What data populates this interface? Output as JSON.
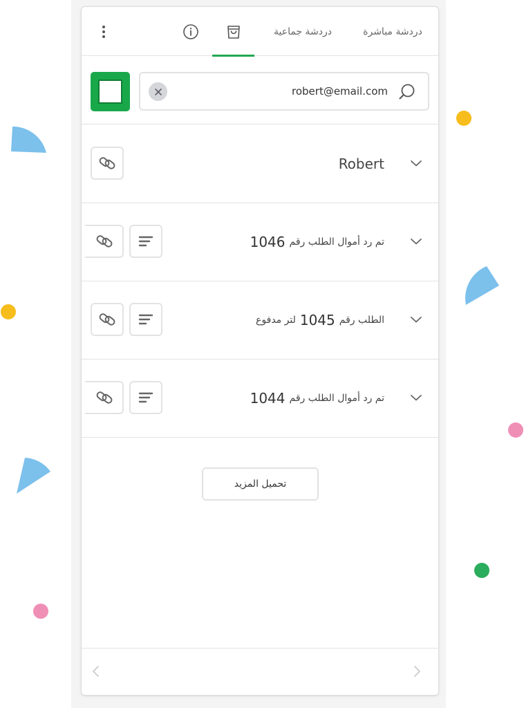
{
  "tabs": {
    "live_chat": "دردشة مباشرة",
    "group_chat": "دردشة جماعية",
    "active_tab": "cart"
  },
  "search": {
    "value": "robert@email.com"
  },
  "rows": [
    {
      "prefix": "",
      "number": "",
      "suffix": "Robert"
    },
    {
      "prefix": "تم رد أموال الطلب رقم",
      "number": "1046",
      "suffix": ""
    },
    {
      "prefix": "الطلب رقم",
      "number": "1045",
      "suffix": "لتر مدفوع"
    },
    {
      "prefix": "تم رد أموال الطلب رقم",
      "number": "1044",
      "suffix": ""
    }
  ],
  "load_more": "تحميل المزيد",
  "colors": {
    "accent": "#22a852",
    "button_green": "#18a84a",
    "confetti_blue": "#7cc0ec",
    "confetti_yellow": "#f7bd1d",
    "confetti_pink": "#f08fb6",
    "confetti_green": "#2aad5c"
  },
  "icons": [
    "kebab-menu-icon",
    "info-icon",
    "shopping-bag-icon",
    "close-icon",
    "search-icon",
    "chevron-down-icon",
    "link-icon",
    "text-lines-icon",
    "chevron-left-icon",
    "chevron-right-icon"
  ]
}
